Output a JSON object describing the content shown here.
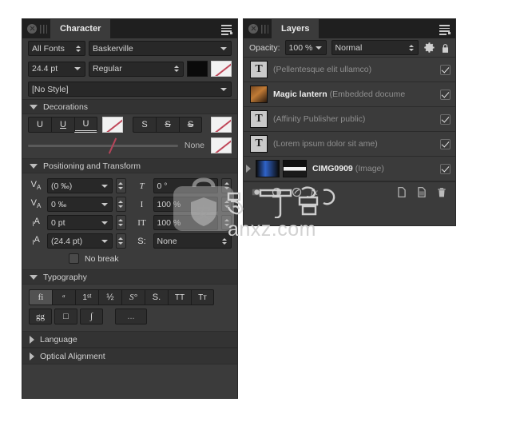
{
  "character_panel": {
    "title": "Character",
    "icons": {
      "close": "close-icon",
      "grip": "drag-grip-icon",
      "menu": "panel-menu-icon"
    },
    "font_filter": {
      "value": "All Fonts"
    },
    "font_family": {
      "value": "Baskerville"
    },
    "font_size": {
      "value": "24.4 pt"
    },
    "font_style": {
      "value": "Regular"
    },
    "fill_color": "#0a0a0a",
    "stroke_color": "none",
    "text_style": {
      "value": "[No Style]"
    },
    "sections": {
      "decorations": {
        "label": "Decorations",
        "underline_buttons": [
          "U",
          "U",
          "U"
        ],
        "strikethrough_buttons": [
          "S",
          "S",
          "S"
        ],
        "decoration_color_none": "None",
        "slider_value_label": "None"
      },
      "positioning": {
        "label": "Positioning and Transform",
        "left_fields": [
          {
            "icon": "kerning-icon",
            "value": "(0 ‰)"
          },
          {
            "icon": "tracking-icon",
            "value": "0 ‰"
          },
          {
            "icon": "baseline-shift-icon",
            "value": "0 pt"
          },
          {
            "icon": "leading-icon",
            "value": "(24.4 pt)"
          }
        ],
        "right_fields": [
          {
            "icon": "skew-icon",
            "label": "T",
            "value": "0 °"
          },
          {
            "icon": "vertical-scale-icon",
            "label": "I",
            "value": "100 %"
          },
          {
            "icon": "horizontal-scale-icon",
            "label": "IT",
            "value": "100 %"
          },
          {
            "icon": "stretch-icon",
            "label": "S:",
            "value": "None"
          }
        ],
        "no_break_label": "No break",
        "no_break_checked": false
      },
      "typography": {
        "label": "Typography",
        "row1": [
          "fi",
          "ᵃ",
          "1ˢᵗ",
          "½",
          "S°",
          "S.",
          "TT",
          "Tт"
        ],
        "row2": [
          "gg",
          "□",
          "∫"
        ],
        "more_label": "..."
      },
      "language": {
        "label": "Language",
        "expanded": false
      },
      "optical_alignment": {
        "label": "Optical Alignment",
        "expanded": false
      }
    }
  },
  "layers_panel": {
    "title": "Layers",
    "icons": {
      "close": "close-icon",
      "grip": "drag-grip-icon",
      "menu": "panel-menu-icon"
    },
    "opacity_label": "Opacity:",
    "opacity_value": "100 %",
    "blend_mode": "Normal",
    "gear_icon": "gear-icon",
    "lock_icon": "lock-icon",
    "rows": [
      {
        "thumb": "text-layer-icon",
        "name": "",
        "detail": "(Pellentesque elit ullamco)",
        "visible": true,
        "expandable": false
      },
      {
        "thumb": "image-layer-icon",
        "name": "Magic lantern",
        "detail": " (Embedded docume",
        "visible": true,
        "expandable": false
      },
      {
        "thumb": "text-layer-icon",
        "name": "",
        "detail": "(Affinity Publisher public)",
        "visible": true,
        "expandable": false
      },
      {
        "thumb": "text-layer-icon",
        "name": "",
        "detail": "(Lorem ipsum dolor sit ame)",
        "visible": true,
        "expandable": false
      },
      {
        "thumb": "picture-layer-icon",
        "name": "CIMG0909",
        "detail": " (Image)",
        "visible": true,
        "expandable": true
      }
    ],
    "bottom_toolbar": [
      {
        "icon": "mask-icon"
      },
      {
        "icon": "adjustment-icon"
      },
      {
        "icon": "live-filter-icon"
      },
      {
        "icon": "fx-icon",
        "label": "fx"
      },
      {
        "icon": "new-layer-icon"
      },
      {
        "icon": "new-pixel-layer-icon"
      },
      {
        "icon": "delete-layer-icon"
      }
    ]
  },
  "watermark": {
    "site": "anxz.com",
    "glyph": "安",
    "bag_icon": "briefcase-shield-watermark"
  }
}
